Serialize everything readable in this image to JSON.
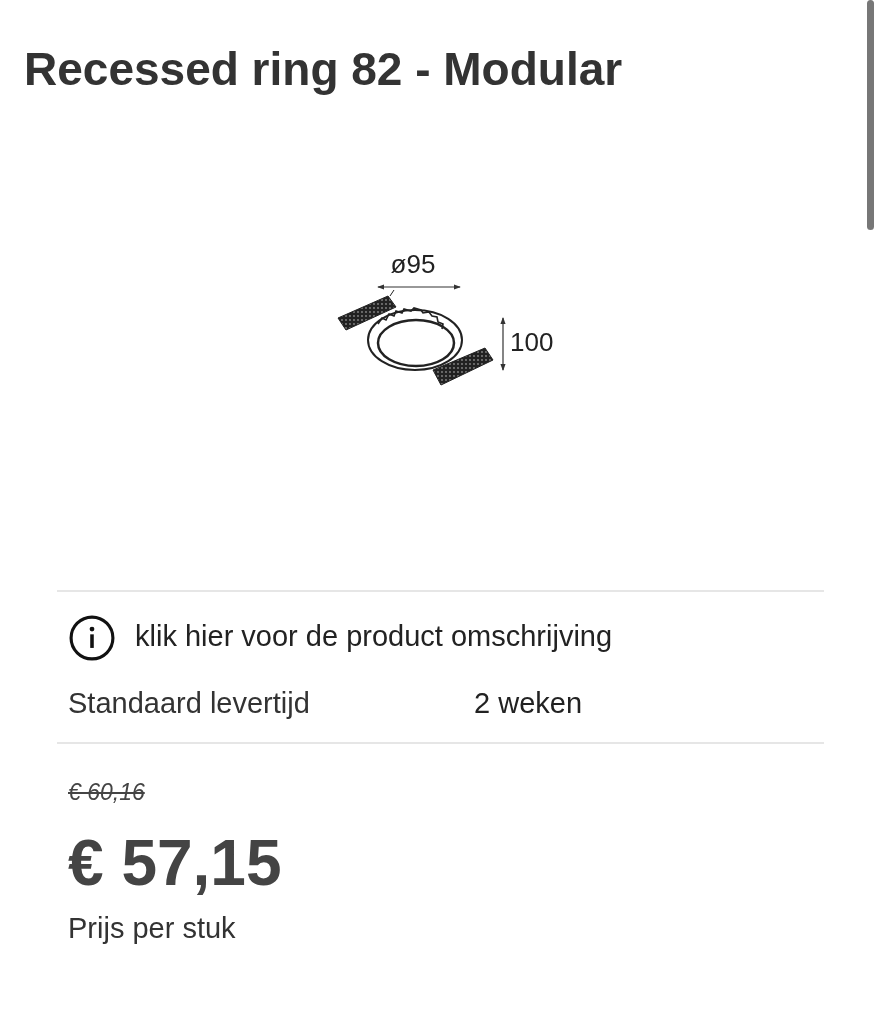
{
  "title": "Recessed ring 82 - Modular",
  "drawing": {
    "width_label": "ø95",
    "height_label": "100"
  },
  "info_link": {
    "label": "klik hier voor de product omschrijving"
  },
  "delivery": {
    "label": "Standaard levertijd",
    "value": "2 weken"
  },
  "price": {
    "old": "€ 60,16",
    "current": "€ 57,15",
    "unit": "Prijs per stuk"
  }
}
